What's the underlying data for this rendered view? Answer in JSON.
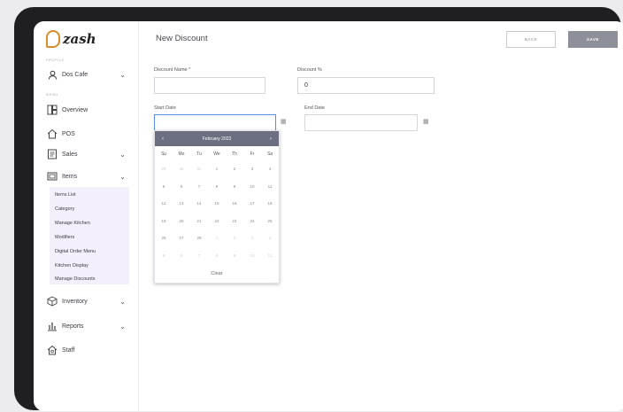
{
  "brand": {
    "name": "zash",
    "accent": "#d98c2b"
  },
  "sidebar": {
    "section_profile": "PROFILE",
    "account": {
      "label": "Dos Cafe",
      "icon": "user-icon"
    },
    "section_menu": "MENU",
    "items": [
      {
        "label": "Overview",
        "icon": "dashboard-icon"
      },
      {
        "label": "POS",
        "icon": "home-icon"
      },
      {
        "label": "Sales",
        "icon": "receipt-icon"
      },
      {
        "label": "Items",
        "icon": "box-icon"
      },
      {
        "label": "Inventory",
        "icon": "cube-icon"
      },
      {
        "label": "Reports",
        "icon": "bar-chart-icon"
      },
      {
        "label": "Staff",
        "icon": "staff-icon"
      }
    ],
    "items_submenu": [
      "Items List",
      "Category",
      "Manage Kitchen",
      "Modifiers",
      "Digital Order Menu",
      "Kitchen Display",
      "Manage Discounts"
    ]
  },
  "page": {
    "title": "New Discount",
    "back_label": "BACK",
    "save_label": "SAVE"
  },
  "form": {
    "discount_name": {
      "label": "Discount Name *",
      "value": ""
    },
    "discount_pct": {
      "label": "Discount %",
      "value": "0"
    },
    "start_date": {
      "label": "Start Date",
      "value": ""
    },
    "end_date": {
      "label": "End Date",
      "value": ""
    }
  },
  "calendar": {
    "month_label": "February 2023",
    "prev": "‹",
    "next": "›",
    "weekdays": [
      "Su",
      "Mo",
      "Tu",
      "We",
      "Th",
      "Fr",
      "Sa"
    ],
    "weeks": [
      [
        "29",
        "30",
        "31",
        "1",
        "2",
        "3",
        "4"
      ],
      [
        "5",
        "6",
        "7",
        "8",
        "9",
        "10",
        "11"
      ],
      [
        "12",
        "13",
        "14",
        "15",
        "16",
        "17",
        "18"
      ],
      [
        "19",
        "20",
        "21",
        "22",
        "23",
        "24",
        "25"
      ],
      [
        "26",
        "27",
        "28",
        "1",
        "2",
        "3",
        "4"
      ],
      [
        "5",
        "6",
        "7",
        "8",
        "9",
        "10",
        "11"
      ]
    ],
    "muted": [
      [
        true,
        true,
        true,
        false,
        false,
        false,
        false
      ],
      [
        false,
        false,
        false,
        false,
        false,
        false,
        false
      ],
      [
        false,
        false,
        false,
        false,
        false,
        false,
        false
      ],
      [
        false,
        false,
        false,
        false,
        false,
        false,
        false
      ],
      [
        false,
        false,
        false,
        true,
        true,
        true,
        true
      ],
      [
        true,
        true,
        true,
        true,
        true,
        true,
        true
      ]
    ],
    "clear_label": "Clear"
  }
}
